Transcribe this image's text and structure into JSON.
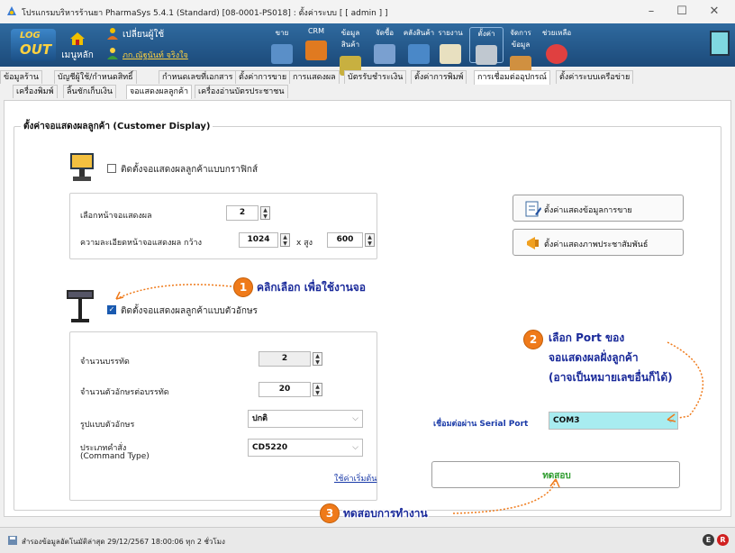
{
  "window": {
    "title": "โปรแกรมบริหารร้านยา PharmaSys 5.4.1 (Standard) [08-0001-PS018] : ตั้งค่าระบบ  [ [ admin ] ]",
    "minimize": "–",
    "maximize": "☐",
    "close": "✕"
  },
  "toolbar": {
    "logout_top": "LOG",
    "logout_bottom": "OUT",
    "home_label": "เมนูหลัก",
    "change_user_label": "เปลี่ยนผู้ใช้",
    "user_name": "ภก.ณัฐนันท์ จริงใจ",
    "items": [
      "ขาย",
      "CRM",
      "ข้อมูลสินค้า",
      "จัดซื้อ",
      "คลังสินค้า",
      "รายงาน",
      "ตั้งค่า",
      "จัดการข้อมูล",
      "ช่วยเหลือ"
    ]
  },
  "tabs_row1": [
    "ข้อมูลร้าน",
    "บัญชีผู้ใช้/กำหนดสิทธิ์",
    "กำหนดเลขที่เอกสาร",
    "ตั้งค่าการขาย",
    "การแสดงผล",
    "บัตรรับชำระเงิน",
    "ตั้งค่าการพิมพ์",
    "การเชื่อมต่ออุปกรณ์",
    "ตั้งค่าระบบเครือข่าย"
  ],
  "tabs_row2": [
    "เครื่องพิมพ์",
    "ลิ้นชักเก็บเงิน",
    "จอแสดงผลลูกค้า",
    "เครื่องอ่านบัตรประชาชน"
  ],
  "section_title": "ตั้งค่าจอแสดงผลลูกค้า (Customer Display)",
  "graphic": {
    "checkbox_label": "ติดตั้งจอแสดงผลลูกค้าแบบกราฟิกส์",
    "checked": false,
    "screen_label": "เลือกหน้าจอแสดงผล",
    "screen_value": "2",
    "resolution_label": "ความละเอียดหน้าจอแสดงผล  กว้าง",
    "width_value": "1024",
    "height_label": "x สูง",
    "height_value": "600"
  },
  "buttons": {
    "sales_display": "ตั้งค่าแสดงข้อมูลการขาย",
    "pr_image": "ตั้งค่าแสดงภาพประชาสัมพันธ์",
    "test": "ทดสอบ",
    "defaults": "ใช้ค่าเริ่มต้น"
  },
  "text_display": {
    "checkbox_label": "ติดตั้งจอแสดงผลลูกค้าแบบตัวอักษร",
    "checked": true,
    "lines_label": "จำนวนบรรทัด",
    "lines_value": "2",
    "chars_label": "จำนวนตัวอักษรต่อบรรทัด",
    "chars_value": "20",
    "font_label": "รูปแบบตัวอักษร",
    "font_value": "ปกติ",
    "cmd_label": "ประเภทคำสั่ง",
    "cmd_label2": "(Command Type)",
    "cmd_value": "CD5220"
  },
  "serial": {
    "label": "เชื่อมต่อผ่าน Serial Port",
    "value": "COM3"
  },
  "callouts": {
    "c1_num": "1",
    "c1_text": "คลิกเลือก เพื่อใช้งานจอ",
    "c2_num": "2",
    "c2_line1": "เลือก Port ของ",
    "c2_line2": "จอแสดงผลฝั่งลูกค้า",
    "c2_line3": "(อาจเป็นหมายเลขอื่นก็ได้)",
    "c3_num": "3",
    "c3_text": "ทดสอบการทำงาน"
  },
  "status": {
    "text": "สำรองข้อมูลอัตโนมัติล่าสุด  29/12/2567 18:00:06  ทุก 2 ชั่วโมง",
    "badge_e": "E",
    "badge_r": "R"
  },
  "colors": {
    "accent": "#1c4a7a",
    "callout_orange": "#ef7a1a",
    "callout_text": "#1a2a9a",
    "serial_bg": "#a8ecf0"
  }
}
